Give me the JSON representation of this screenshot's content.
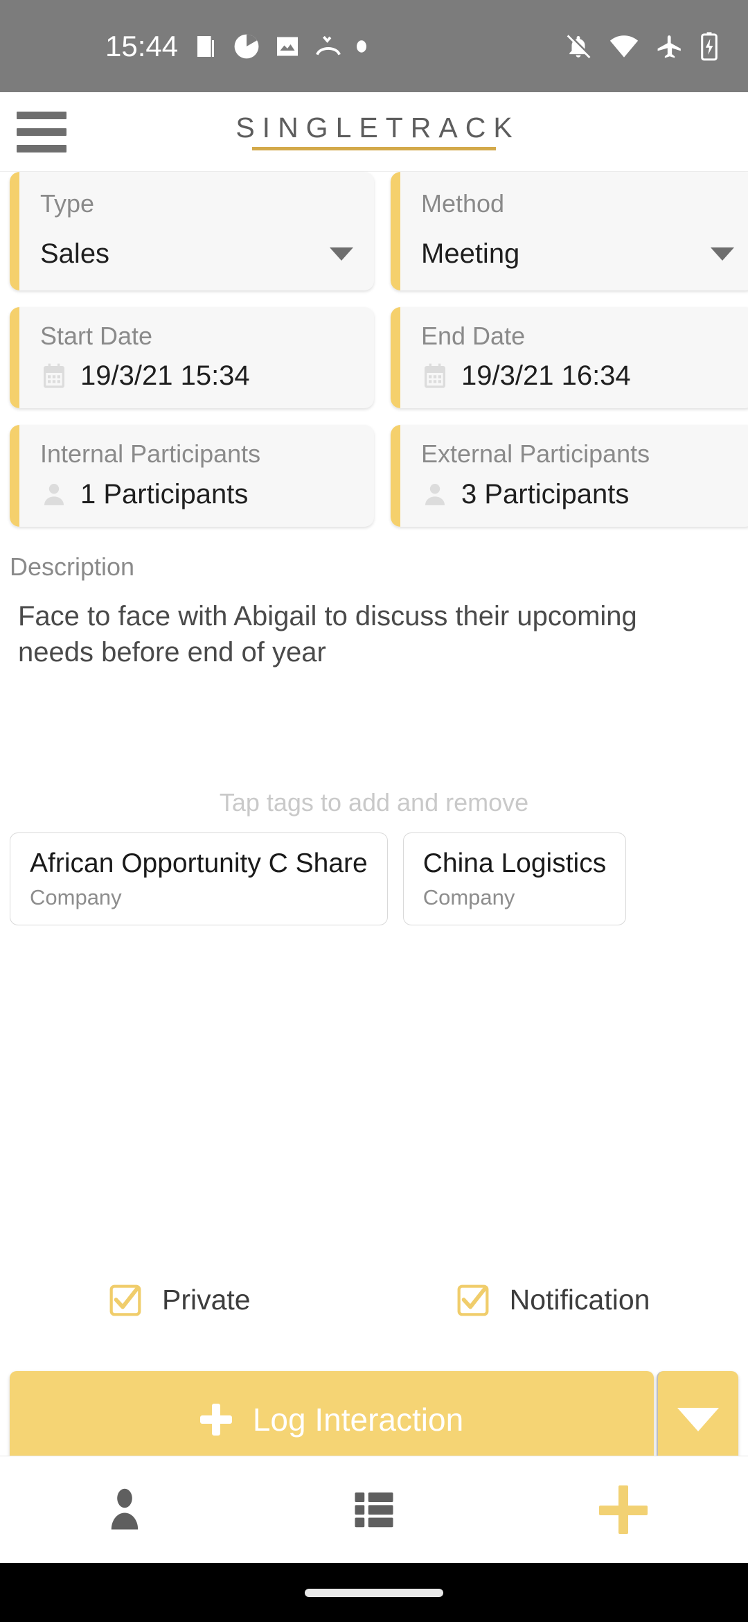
{
  "status_bar": {
    "time": "15:44",
    "left_icons": [
      "news-icon",
      "pie-chart-icon",
      "image-warning-icon",
      "call-missed-icon",
      "dot-icon"
    ],
    "right_icons": [
      "notifications-off-icon",
      "wifi-icon",
      "airplane-mode-icon",
      "battery-charging-icon"
    ],
    "background_color": "#7c7c7c"
  },
  "header": {
    "menu_icon": "hamburger-menu-icon",
    "logo_text": "SINGLETRACK",
    "logo_rule_color": "#d3a94a"
  },
  "theme": {
    "accent": "#f5d474",
    "accent_bar": "#f5d06c",
    "card_bg": "#f7f7f7",
    "label_color": "#8a8a8a",
    "value_color": "#1f1f1f"
  },
  "fields": {
    "type": {
      "label": "Type",
      "value": "Sales",
      "caret": "chevron-down-icon"
    },
    "method": {
      "label": "Method",
      "value": "Meeting",
      "caret": "chevron-down-icon"
    },
    "start_date": {
      "label": "Start Date",
      "value": "19/3/21 15:34",
      "icon": "calendar-icon"
    },
    "end_date": {
      "label": "End Date",
      "value": "19/3/21 16:34",
      "icon": "calendar-icon"
    },
    "internal_participants": {
      "label": "Internal Participants",
      "value": "1 Participants",
      "icon": "person-icon"
    },
    "external_participants": {
      "label": "External Participants",
      "value": "3 Participants",
      "icon": "person-icon"
    }
  },
  "description": {
    "label": "Description",
    "text": "Face to face with Abigail to discuss their upcoming needs before end of year"
  },
  "tags": {
    "hint": "Tap tags to add and remove",
    "items": [
      {
        "name": "African Opportunity C Share",
        "type": "Company"
      },
      {
        "name": "China Logistics",
        "type": "Company"
      }
    ]
  },
  "checkboxes": [
    {
      "label": "Private",
      "checked": true
    },
    {
      "label": "Notification",
      "checked": true
    }
  ],
  "action_bar": {
    "plus_icon": "plus-icon",
    "label": "Log Interaction",
    "dropdown_icon": "chevron-down-icon"
  },
  "bottom_nav": [
    {
      "name": "person-icon",
      "label": ""
    },
    {
      "name": "list-grid-icon",
      "label": ""
    },
    {
      "name": "plus-icon",
      "label": ""
    }
  ]
}
